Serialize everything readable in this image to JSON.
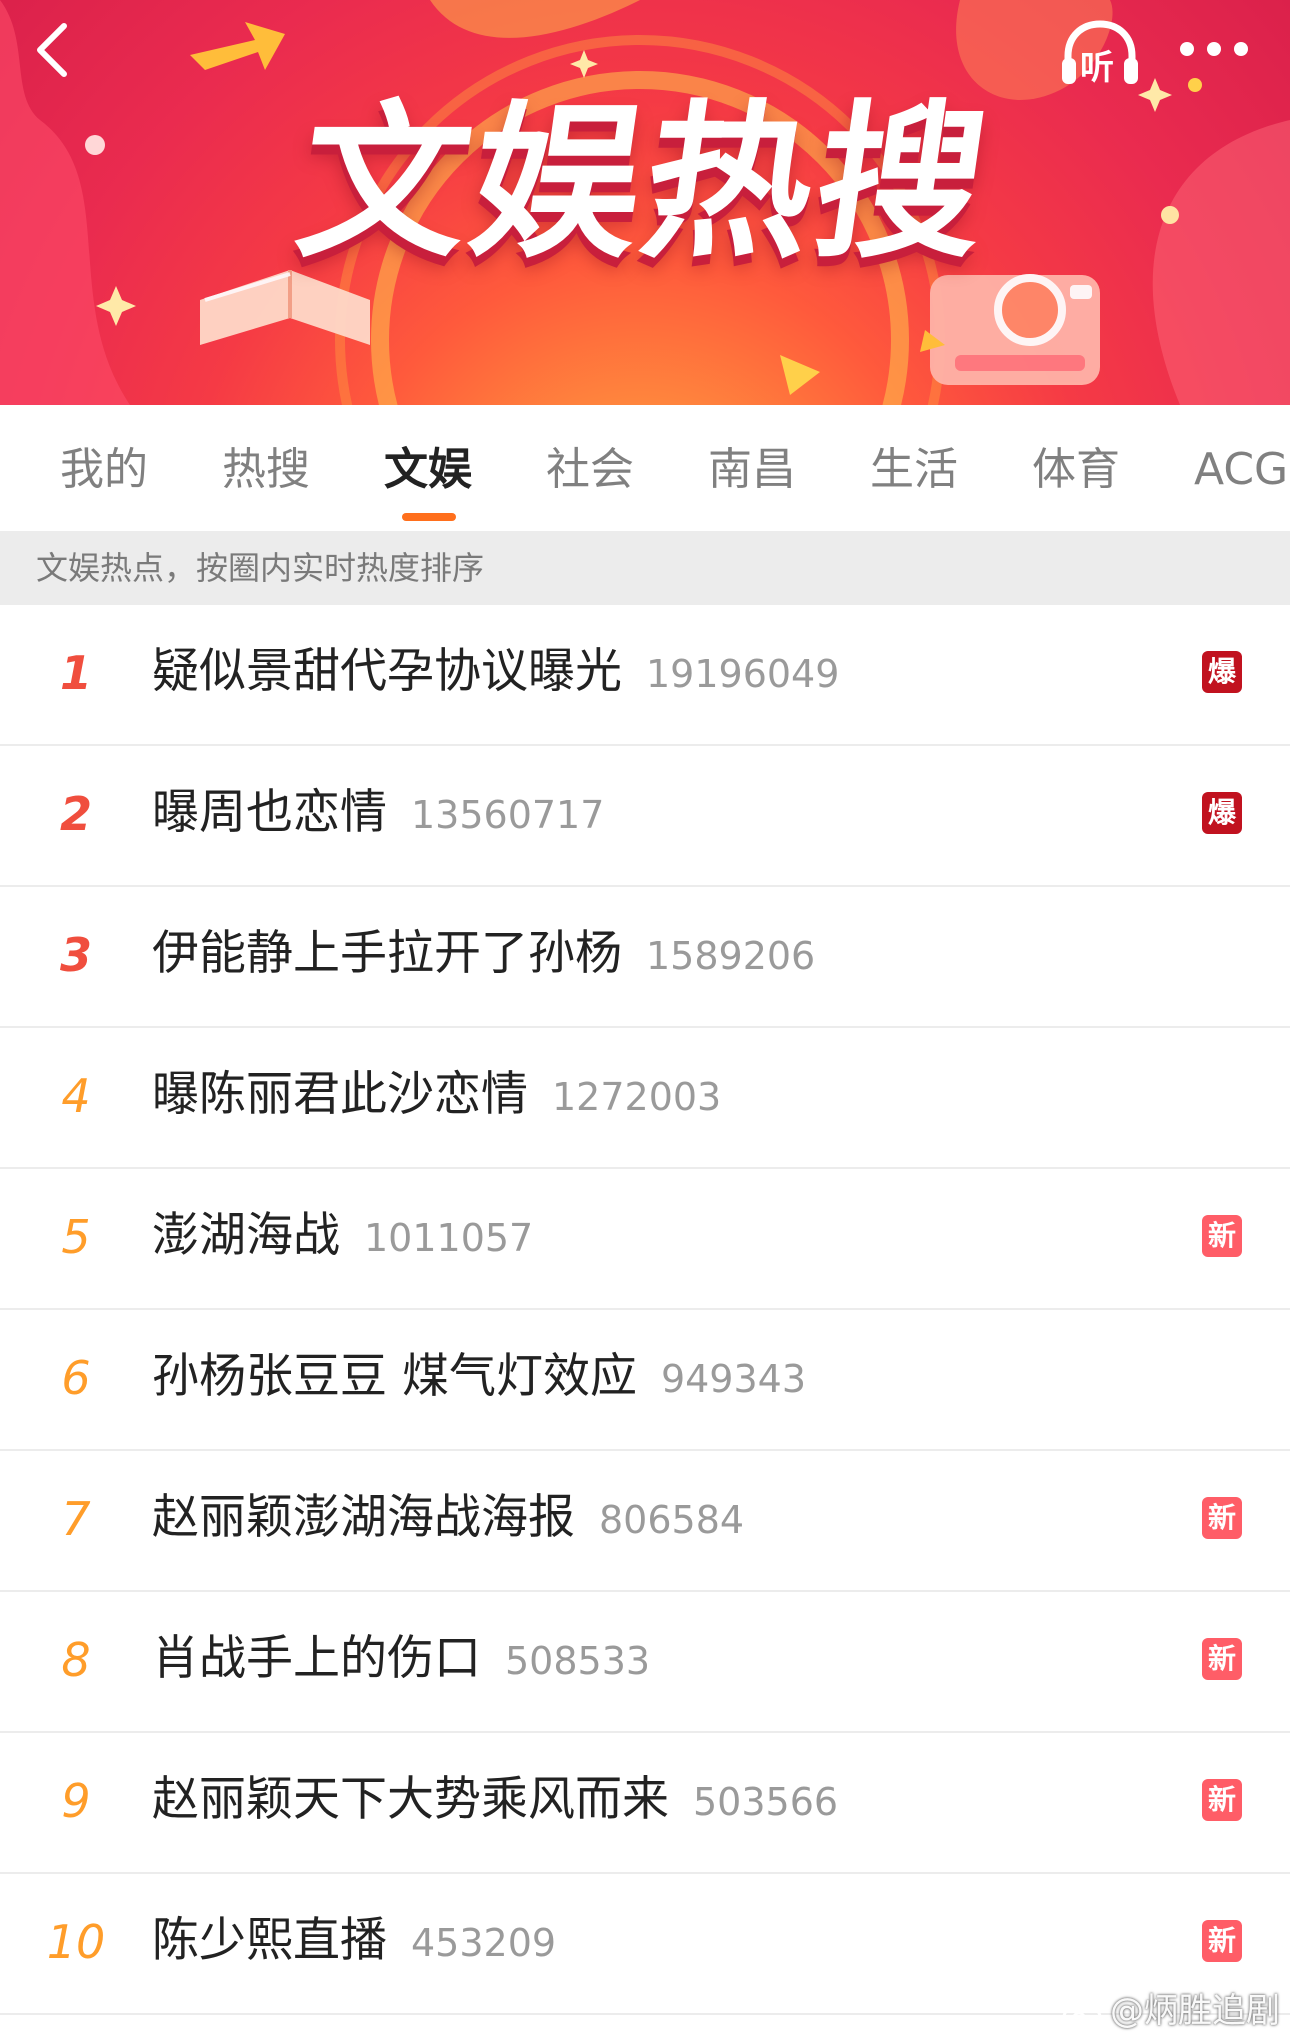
{
  "banner": {
    "title": "文娱热搜",
    "listen_label": "听",
    "back_icon": "chevron-left-icon",
    "more_icon": "more-dots-icon"
  },
  "tabs": [
    {
      "label": "我的"
    },
    {
      "label": "热搜"
    },
    {
      "label": "文娱",
      "active": true
    },
    {
      "label": "社会"
    },
    {
      "label": "南昌"
    },
    {
      "label": "生活"
    },
    {
      "label": "体育"
    },
    {
      "label": "ACG"
    }
  ],
  "subtitle": "文娱热点，按圈内实时热度排序",
  "colors": {
    "accent": "#ff6f1c",
    "rank_top": "#f04e3e",
    "rank_other": "#ff9d2a",
    "badge_hot": "#c1121f",
    "badge_new": "#ff5d67"
  },
  "list": [
    {
      "rank": "1",
      "topic": "疑似景甜代孕协议曝光",
      "count": "19196049",
      "badge": "爆"
    },
    {
      "rank": "2",
      "topic": "曝周也恋情",
      "count": "13560717",
      "badge": "爆"
    },
    {
      "rank": "3",
      "topic": "伊能静上手拉开了孙杨",
      "count": "1589206",
      "badge": ""
    },
    {
      "rank": "4",
      "topic": "曝陈丽君此沙恋情",
      "count": "1272003",
      "badge": ""
    },
    {
      "rank": "5",
      "topic": "澎湖海战",
      "count": "1011057",
      "badge": "新"
    },
    {
      "rank": "6",
      "topic": "孙杨张豆豆 煤气灯效应",
      "count": "949343",
      "badge": ""
    },
    {
      "rank": "7",
      "topic": "赵丽颖澎湖海战海报",
      "count": "806584",
      "badge": "新"
    },
    {
      "rank": "8",
      "topic": "肖战手上的伤口",
      "count": "508533",
      "badge": "新"
    },
    {
      "rank": "9",
      "topic": "赵丽颖天下大势乘风而来",
      "count": "503566",
      "badge": "新"
    },
    {
      "rank": "10",
      "topic": "陈少熙直播",
      "count": "453209",
      "badge": "新"
    }
  ],
  "watermark": "@炳胜追剧"
}
